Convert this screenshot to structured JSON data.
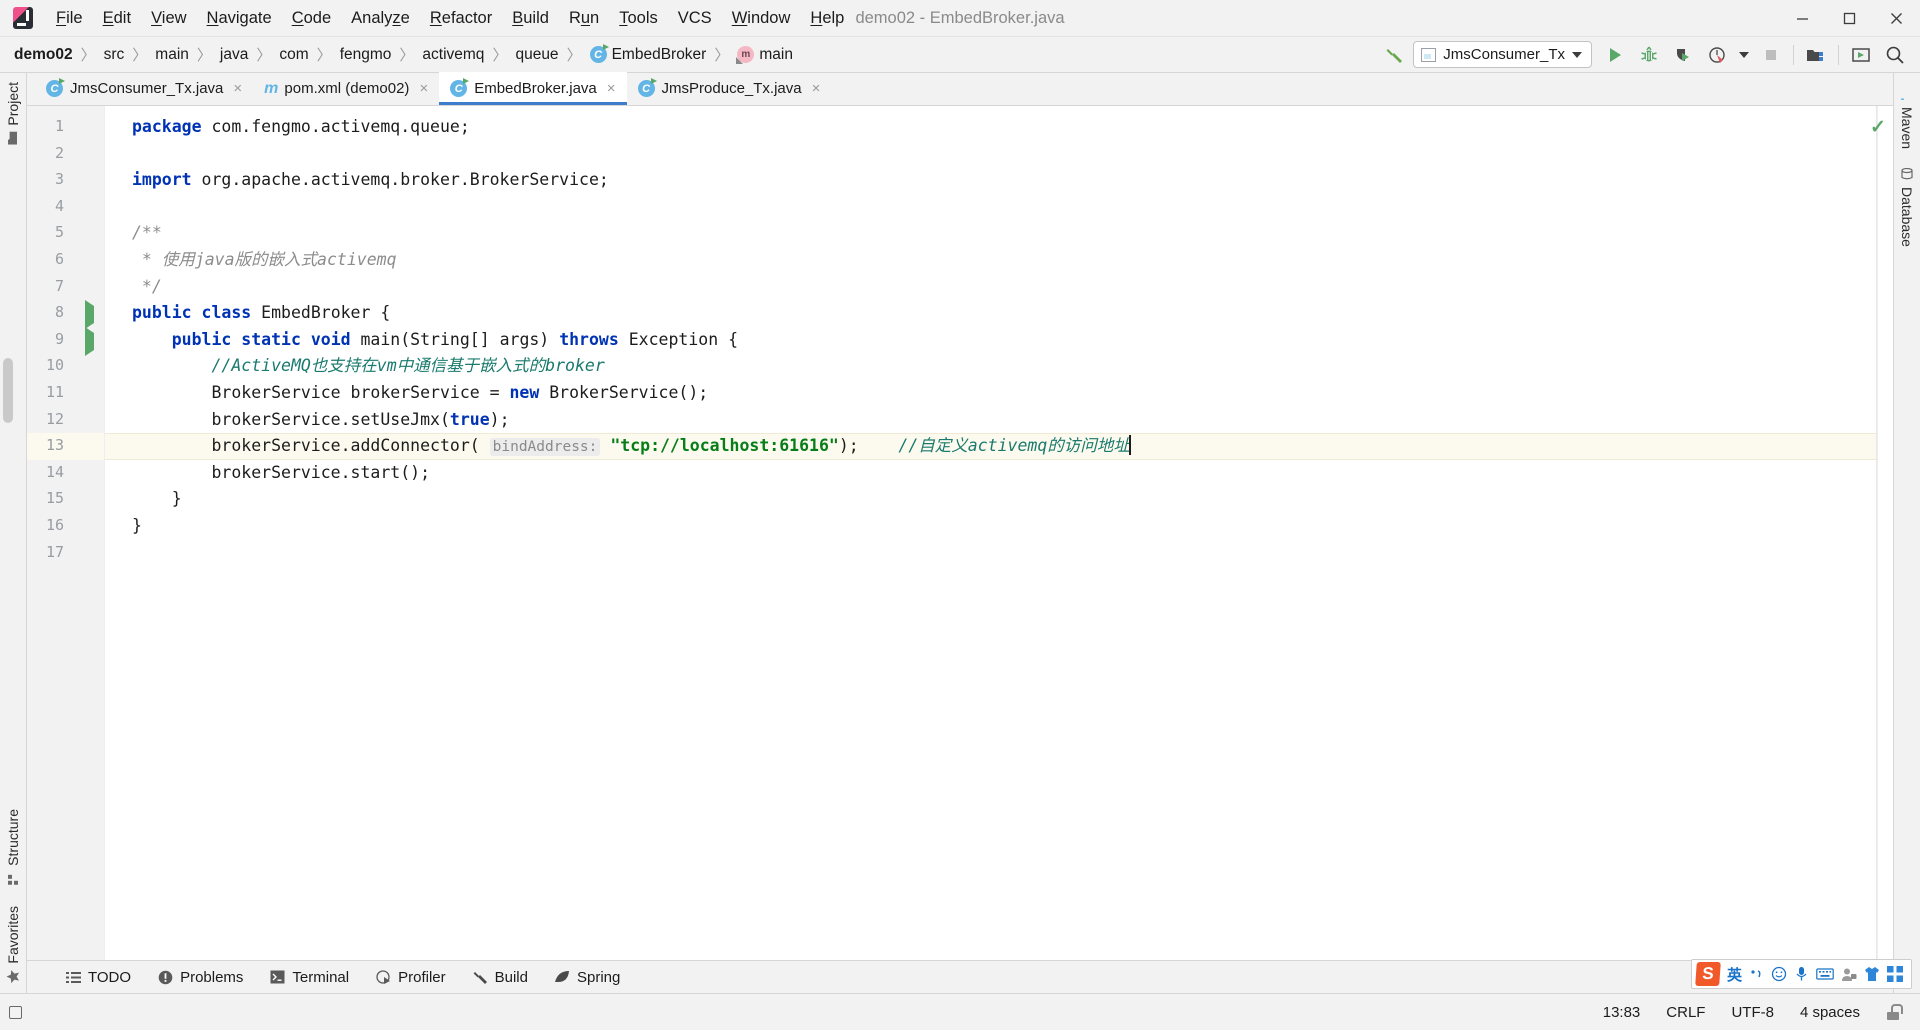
{
  "window": {
    "title": "demo02 - EmbedBroker.java",
    "controls": [
      "minimize",
      "maximize",
      "close"
    ]
  },
  "menubar": {
    "items": [
      {
        "label": "File",
        "mnemonic": "F"
      },
      {
        "label": "Edit",
        "mnemonic": "E"
      },
      {
        "label": "View",
        "mnemonic": "V"
      },
      {
        "label": "Navigate",
        "mnemonic": "N"
      },
      {
        "label": "Code",
        "mnemonic": "C"
      },
      {
        "label": "Analyze",
        "mnemonic": "z"
      },
      {
        "label": "Refactor",
        "mnemonic": "R"
      },
      {
        "label": "Build",
        "mnemonic": "B"
      },
      {
        "label": "Run",
        "mnemonic": "u"
      },
      {
        "label": "Tools",
        "mnemonic": "T"
      },
      {
        "label": "VCS",
        "mnemonic": ""
      },
      {
        "label": "Window",
        "mnemonic": "W"
      },
      {
        "label": "Help",
        "mnemonic": "H"
      }
    ]
  },
  "breadcrumb": {
    "items": [
      {
        "label": "demo02",
        "icon": "none"
      },
      {
        "label": "src",
        "icon": "none"
      },
      {
        "label": "main",
        "icon": "none"
      },
      {
        "label": "java",
        "icon": "none"
      },
      {
        "label": "com",
        "icon": "none"
      },
      {
        "label": "fengmo",
        "icon": "none"
      },
      {
        "label": "activemq",
        "icon": "none"
      },
      {
        "label": "queue",
        "icon": "none"
      },
      {
        "label": "EmbedBroker",
        "icon": "class-icon"
      },
      {
        "label": "main",
        "icon": "method-icon"
      }
    ]
  },
  "toolbar": {
    "build_label": "build-hammer-icon",
    "run_config": "JmsConsumer_Tx",
    "buttons": [
      {
        "name": "run-button",
        "icon": "play-icon"
      },
      {
        "name": "debug-button",
        "icon": "bug-icon"
      },
      {
        "name": "run-with-coverage-button",
        "icon": "coverage-icon"
      },
      {
        "name": "profile-button",
        "icon": "profiler-icon"
      },
      {
        "name": "stop-button",
        "icon": "stop-icon"
      },
      {
        "name": "project-structure-button",
        "icon": "project-structure-icon"
      },
      {
        "name": "updates-button",
        "icon": "terminal-window-icon"
      },
      {
        "name": "search-everywhere-button",
        "icon": "search-icon"
      }
    ]
  },
  "tabs": [
    {
      "label": "JmsConsumer_Tx.java",
      "icon": "java-class-icon",
      "active": false
    },
    {
      "label": "pom.xml (demo02)",
      "icon": "maven-xml-icon",
      "active": false
    },
    {
      "label": "EmbedBroker.java",
      "icon": "java-class-icon",
      "active": true
    },
    {
      "label": "JmsProduce_Tx.java",
      "icon": "java-class-icon",
      "active": false
    }
  ],
  "left_rail": [
    {
      "label": "Project",
      "icon": "project-folder-icon"
    },
    {
      "label": "Structure",
      "icon": "structure-icon"
    },
    {
      "label": "Favorites",
      "icon": "star-icon"
    }
  ],
  "right_rail": [
    {
      "label": "Maven",
      "icon": "maven-icon"
    },
    {
      "label": "Database",
      "icon": "database-icon"
    }
  ],
  "editor": {
    "file": "EmbedBroker.java",
    "total_lines": 17,
    "highlighted_line": 13,
    "inspection_status": "ok",
    "lines": [
      {
        "n": 1,
        "mark": "none",
        "fold": "none",
        "tokens": [
          {
            "t": "package",
            "c": "kw"
          },
          {
            "t": " com.fengmo.activemq.queue;",
            "c": "plain"
          }
        ]
      },
      {
        "n": 2,
        "mark": "none",
        "fold": "none",
        "tokens": []
      },
      {
        "n": 3,
        "mark": "none",
        "fold": "none",
        "tokens": [
          {
            "t": "import",
            "c": "kw"
          },
          {
            "t": " org.apache.activemq.broker.BrokerService;",
            "c": "plain"
          }
        ]
      },
      {
        "n": 4,
        "mark": "none",
        "fold": "none",
        "tokens": []
      },
      {
        "n": 5,
        "mark": "none",
        "fold": "open",
        "tokens": [
          {
            "t": "/**",
            "c": "cmt"
          }
        ]
      },
      {
        "n": 6,
        "mark": "none",
        "fold": "none",
        "tokens": [
          {
            "t": " * 使用java版的嵌入式activemq",
            "c": "cmt"
          }
        ]
      },
      {
        "n": 7,
        "mark": "none",
        "fold": "close",
        "tokens": [
          {
            "t": " */",
            "c": "cmt"
          }
        ]
      },
      {
        "n": 8,
        "mark": "run",
        "fold": "none",
        "tokens": [
          {
            "t": "public class",
            "c": "kw"
          },
          {
            "t": " EmbedBroker {",
            "c": "plain"
          }
        ]
      },
      {
        "n": 9,
        "mark": "run",
        "fold": "open",
        "tokens": [
          {
            "t": "    ",
            "c": "plain"
          },
          {
            "t": "public static void",
            "c": "kw"
          },
          {
            "t": " main(String[] args) ",
            "c": "plain"
          },
          {
            "t": "throws",
            "c": "kw"
          },
          {
            "t": " Exception {",
            "c": "plain"
          }
        ]
      },
      {
        "n": 10,
        "mark": "none",
        "fold": "none",
        "tokens": [
          {
            "t": "        //ActiveMQ也支持在vm中通信基于嵌入式的broker",
            "c": "cmt-ln"
          }
        ]
      },
      {
        "n": 11,
        "mark": "none",
        "fold": "none",
        "tokens": [
          {
            "t": "        BrokerService brokerService = ",
            "c": "plain"
          },
          {
            "t": "new",
            "c": "kw"
          },
          {
            "t": " BrokerService();",
            "c": "plain"
          }
        ]
      },
      {
        "n": 12,
        "mark": "none",
        "fold": "none",
        "tokens": [
          {
            "t": "        brokerService.setUseJmx(",
            "c": "plain"
          },
          {
            "t": "true",
            "c": "kw"
          },
          {
            "t": ");",
            "c": "plain"
          }
        ]
      },
      {
        "n": 13,
        "mark": "none",
        "fold": "none",
        "tokens": [
          {
            "t": "        brokerService.addConnector( ",
            "c": "plain"
          },
          {
            "t": "bindAddress:",
            "c": "hint"
          },
          {
            "t": " ",
            "c": "plain"
          },
          {
            "t": "\"tcp://localhost:61616\"",
            "c": "str"
          },
          {
            "t": ");    ",
            "c": "plain"
          },
          {
            "t": "//自定义activemq的访问地址",
            "c": "cmt-ln"
          },
          {
            "t": "",
            "c": "caret"
          }
        ]
      },
      {
        "n": 14,
        "mark": "none",
        "fold": "none",
        "tokens": [
          {
            "t": "        brokerService.start();",
            "c": "plain"
          }
        ]
      },
      {
        "n": 15,
        "mark": "none",
        "fold": "close",
        "tokens": [
          {
            "t": "    }",
            "c": "plain"
          }
        ]
      },
      {
        "n": 16,
        "mark": "none",
        "fold": "none",
        "tokens": [
          {
            "t": "}",
            "c": "plain"
          }
        ]
      },
      {
        "n": 17,
        "mark": "none",
        "fold": "none",
        "tokens": []
      }
    ]
  },
  "bottom_bar": [
    {
      "label": "TODO",
      "icon": "todo-list-icon"
    },
    {
      "label": "Problems",
      "icon": "problems-icon"
    },
    {
      "label": "Terminal",
      "icon": "terminal-icon"
    },
    {
      "label": "Profiler",
      "icon": "profiler-icon"
    },
    {
      "label": "Build",
      "icon": "hammer-icon"
    },
    {
      "label": "Spring",
      "icon": "spring-leaf-icon"
    }
  ],
  "ime": {
    "name": "S",
    "mode": "英",
    "icons": [
      "punctuation-icon",
      "emoji-icon",
      "voice-icon",
      "keyboard-icon",
      "user-icon",
      "skin-icon",
      "apps-icon"
    ]
  },
  "statusbar": {
    "caret_position": "13:83",
    "line_separator": "CRLF",
    "encoding": "UTF-8",
    "indent": "4 spaces",
    "lock": "unlocked-icon"
  },
  "colors": {
    "accent_blue": "#3d7dcc",
    "run_green": "#59a869",
    "keyword": "#0033b3",
    "string": "#067d17",
    "comment": "#8c8c8c",
    "line_comment": "#1a7a6d",
    "highlight_row": "#fcfaef",
    "chrome": "#f2f2f2"
  }
}
